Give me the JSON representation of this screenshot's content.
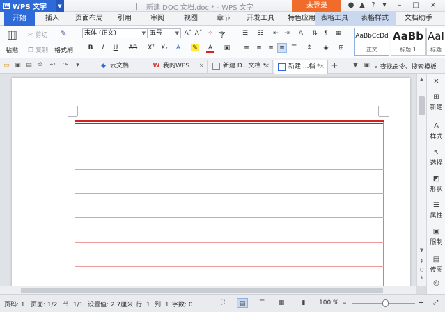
{
  "titlebar": {
    "app_name": "WPS 文字",
    "app_logo": "W",
    "doc_title": "新建 DOC 文档.doc * - WPS 文字",
    "login_label": "未登录",
    "controls": [
      "●",
      "▲",
      "?",
      "▾",
      "–",
      "□",
      "×"
    ]
  },
  "menu": {
    "tabs": [
      "开始",
      "插入",
      "页面布局",
      "引用",
      "审阅",
      "视图",
      "章节",
      "开发工具",
      "特色应用",
      "表格工具",
      "表格样式",
      "文档助手"
    ],
    "active": "开始"
  },
  "ribbon": {
    "paste": "粘贴",
    "cut": "剪切",
    "copy": "复制",
    "format_painter": "格式刷",
    "font_name": "宋体 (正文)",
    "font_size": "五号",
    "bold": "B",
    "italic": "I",
    "underline": "U",
    "strike": "AB",
    "superscript": "X²",
    "subscript": "X₂",
    "styles": [
      {
        "sample": "AaBbCcDd",
        "name": "正文"
      },
      {
        "sample": "AaBb",
        "name": "标题 1"
      },
      {
        "sample": "AaI",
        "name": "标题"
      }
    ]
  },
  "doc_tabs": [
    {
      "label": "云文档",
      "icon": "cloud-icon"
    },
    {
      "label": "我的WPS",
      "icon": "wps-logo-icon"
    },
    {
      "label": "新建 D...文档 *",
      "icon": "document-icon"
    },
    {
      "label": "新建 ...档 *",
      "icon": "document-icon"
    }
  ],
  "search": {
    "label": "查找命令、搜索模板"
  },
  "taskpane": [
    "新建",
    "样式",
    "选择",
    "形状",
    "属性",
    "限制",
    "传图"
  ],
  "status": {
    "page_number": "页码: 1",
    "pages": "页面: 1/2",
    "section": "节: 1/1",
    "setting": "设置值: 2.7厘米",
    "row": "行: 1",
    "col": "列: 1",
    "words": "字数: 0",
    "zoom": "100 %",
    "zoom_minus": "–",
    "zoom_plus": "+"
  },
  "colors": {
    "accent": "#2f6bd8",
    "login": "#f16b2a",
    "table_line": "#d61f1f"
  }
}
